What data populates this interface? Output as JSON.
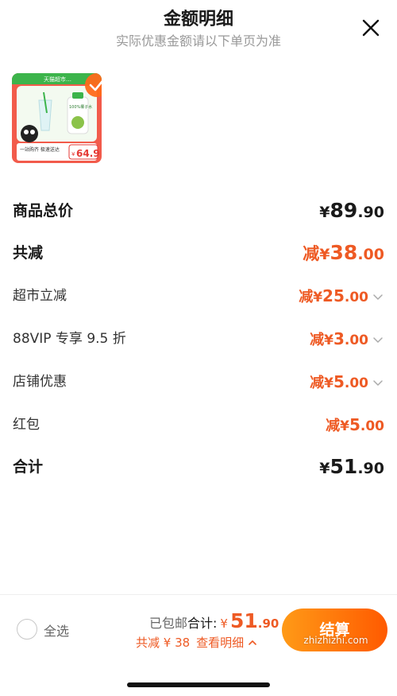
{
  "header": {
    "title": "金额明细",
    "subtitle": "实际优惠金额请以下单页为准"
  },
  "product": {
    "banner_text": "天猫超市…",
    "tag_text": "100%椰子水",
    "slogan_text": "一站购齐 极速送达",
    "price_badge_symbol": "¥",
    "price_badge": "64.9",
    "selected": true
  },
  "rows": [
    {
      "label": "商品总价",
      "prefix": "",
      "symbol": "¥",
      "int": "89",
      "dec": ".90",
      "color": "black",
      "style": "main",
      "chevron": false
    },
    {
      "label": "共减",
      "prefix": "减",
      "symbol": "¥",
      "int": "38",
      "dec": ".00",
      "color": "orange",
      "style": "main",
      "chevron": false
    },
    {
      "label": "超市立减",
      "prefix": "减",
      "symbol": "¥",
      "int": "25",
      "dec": ".00",
      "color": "orange",
      "style": "sub",
      "chevron": true
    },
    {
      "label": "88VIP 专享 9.5 折",
      "prefix": "减",
      "symbol": "¥",
      "int": "3",
      "dec": ".00",
      "color": "orange",
      "style": "sub",
      "chevron": true
    },
    {
      "label": "店铺优惠",
      "prefix": "减",
      "symbol": "¥",
      "int": "5",
      "dec": ".00",
      "color": "orange",
      "style": "sub",
      "chevron": true
    },
    {
      "label": "红包",
      "prefix": "减",
      "symbol": "¥",
      "int": "5",
      "dec": ".00",
      "color": "orange",
      "style": "sub",
      "chevron": false
    },
    {
      "label": "合计",
      "prefix": "",
      "symbol": "¥",
      "int": "51",
      "dec": ".90",
      "color": "black",
      "style": "main",
      "chevron": false
    }
  ],
  "footer": {
    "select_all": "全选",
    "shipping": "已包邮",
    "total_label": "合计:",
    "total_symbol": "¥",
    "total_int": "51",
    "total_dec": ".90",
    "discount_text": "共减 ¥ 38",
    "detail_link": "查看明细",
    "checkout_label": "结算"
  },
  "watermark": "zhizhizhi.com",
  "colors": {
    "accent": "#ee5a24",
    "checkout_start": "#ff9a17",
    "checkout_end": "#ff5a00",
    "product_bg": "#f25b4b"
  }
}
